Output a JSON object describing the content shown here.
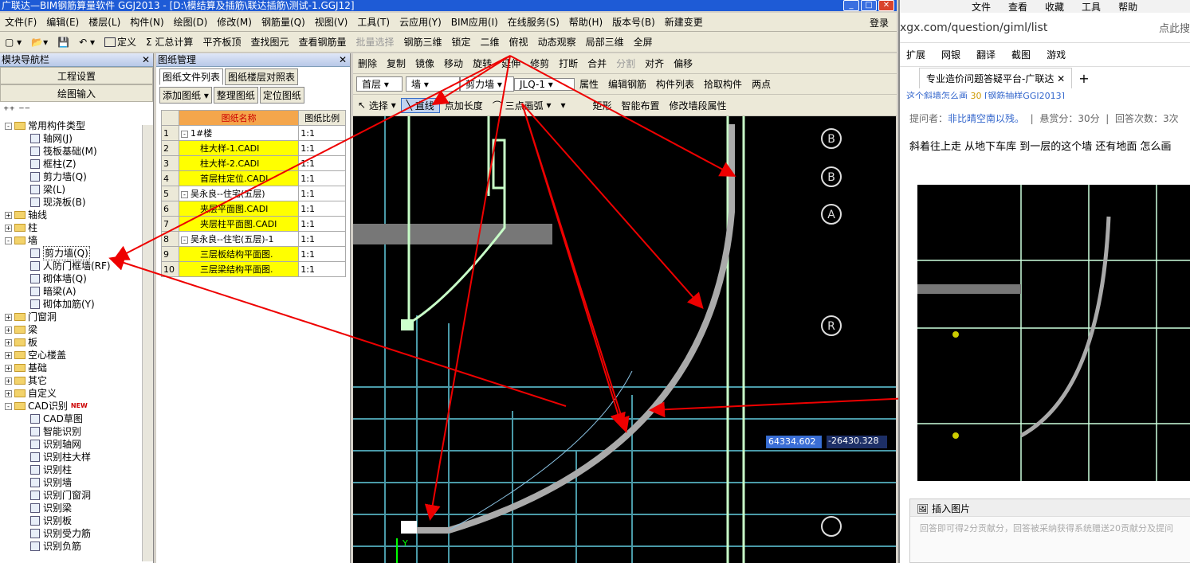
{
  "title": "广联达—BIM钢筋算量软件 GGJ2013 - [D:\\模结算及插筋\\联达插筋\\测试-1.GGJ12]",
  "menu": [
    "文件(F)",
    "编辑(E)",
    "楼层(L)",
    "构件(N)",
    "绘图(D)",
    "修改(M)",
    "钢筋量(Q)",
    "视图(V)",
    "工具(T)",
    "云应用(Y)",
    "BIM应用(I)",
    "在线服务(S)",
    "帮助(H)",
    "版本号(B)",
    "新建变更"
  ],
  "login": "登录",
  "toolbar1": [
    "定义",
    "Σ 汇总计算",
    "平齐板顶",
    "查找图元",
    "查看钢筋量",
    "批量选择",
    "钢筋三维",
    "锁定",
    "二维",
    "俯视",
    "动态观察",
    "局部三维",
    "全屏"
  ],
  "toolbar2": [
    "删除",
    "复制",
    "镜像",
    "移动",
    "旋转",
    "延伸",
    "修剪",
    "打断",
    "合并",
    "分割",
    "对齐",
    "偏移"
  ],
  "toolbar3": [
    "首层",
    "墙",
    "剪力墙",
    "JLQ-1",
    "属性",
    "编辑钢筋",
    "构件列表",
    "拾取构件",
    "两点"
  ],
  "toolbar4": [
    "选择",
    "直线",
    "点加长度",
    "三点画弧",
    "矩形",
    "智能布置",
    "修改墙段属性"
  ],
  "leftnav": {
    "header": "模块导航栏",
    "btn1": "工程设置",
    "btn2": "绘图输入",
    "tree": [
      {
        "lvl": 0,
        "pm": "-",
        "folder": true,
        "label": "常用构件类型"
      },
      {
        "lvl": 1,
        "label": "轴网(J)"
      },
      {
        "lvl": 1,
        "label": "筏板基础(M)"
      },
      {
        "lvl": 1,
        "label": "框柱(Z)"
      },
      {
        "lvl": 1,
        "label": "剪力墙(Q)"
      },
      {
        "lvl": 1,
        "label": "梁(L)"
      },
      {
        "lvl": 1,
        "label": "现浇板(B)"
      },
      {
        "lvl": 0,
        "pm": "+",
        "folder": true,
        "label": "轴线"
      },
      {
        "lvl": 0,
        "pm": "+",
        "folder": true,
        "label": "柱"
      },
      {
        "lvl": 0,
        "pm": "-",
        "folder": true,
        "label": "墙"
      },
      {
        "lvl": 1,
        "label": "剪力墙(Q)",
        "sel": true
      },
      {
        "lvl": 1,
        "label": "人防门框墙(RF)"
      },
      {
        "lvl": 1,
        "label": "砌体墙(Q)"
      },
      {
        "lvl": 1,
        "label": "暗梁(A)"
      },
      {
        "lvl": 1,
        "label": "砌体加筋(Y)"
      },
      {
        "lvl": 0,
        "pm": "+",
        "folder": true,
        "label": "门窗洞"
      },
      {
        "lvl": 0,
        "pm": "+",
        "folder": true,
        "label": "梁"
      },
      {
        "lvl": 0,
        "pm": "+",
        "folder": true,
        "label": "板"
      },
      {
        "lvl": 0,
        "pm": "+",
        "folder": true,
        "label": "空心楼盖"
      },
      {
        "lvl": 0,
        "pm": "+",
        "folder": true,
        "label": "基础"
      },
      {
        "lvl": 0,
        "pm": "+",
        "folder": true,
        "label": "其它"
      },
      {
        "lvl": 0,
        "pm": "+",
        "folder": true,
        "label": "自定义"
      },
      {
        "lvl": 0,
        "pm": "-",
        "folder": true,
        "label": "CAD识别",
        "new": "NEW"
      },
      {
        "lvl": 1,
        "label": "CAD草图"
      },
      {
        "lvl": 1,
        "label": "智能识别"
      },
      {
        "lvl": 1,
        "label": "识别轴网"
      },
      {
        "lvl": 1,
        "label": "识别柱大样"
      },
      {
        "lvl": 1,
        "label": "识别柱"
      },
      {
        "lvl": 1,
        "label": "识别墙"
      },
      {
        "lvl": 1,
        "label": "识别门窗洞"
      },
      {
        "lvl": 1,
        "label": "识别梁"
      },
      {
        "lvl": 1,
        "label": "识别板"
      },
      {
        "lvl": 1,
        "label": "识别受力筋"
      },
      {
        "lvl": 1,
        "label": "识别负筋"
      }
    ]
  },
  "drawing": {
    "header": "图纸管理",
    "tabs": [
      "图纸文件列表",
      "图纸楼层对照表"
    ],
    "buttons": [
      "添加图纸",
      "整理图纸",
      "定位图纸"
    ],
    "col1": "图纸名称",
    "col2": "图纸比例",
    "rows": [
      {
        "n": "1",
        "name": "1#楼",
        "scale": "1:1",
        "group": true
      },
      {
        "n": "2",
        "name": "柱大样-1.CADI",
        "scale": "1:1"
      },
      {
        "n": "3",
        "name": "柱大样-2.CADI",
        "scale": "1:1"
      },
      {
        "n": "4",
        "name": "首层柱定位.CADI",
        "scale": "1:1"
      },
      {
        "n": "5",
        "name": "吴永良--住宅(五层)",
        "scale": "1:1",
        "group": true
      },
      {
        "n": "6",
        "name": "夹层平面图.CADI",
        "scale": "1:1"
      },
      {
        "n": "7",
        "name": "夹层柱平面图.CADI",
        "scale": "1:1"
      },
      {
        "n": "8",
        "name": "吴永良--住宅(五层)-1",
        "scale": "1:1",
        "group": true
      },
      {
        "n": "9",
        "name": "三层板结构平面图.",
        "scale": "1:1"
      },
      {
        "n": "10",
        "name": "三层梁结构平面图.",
        "scale": "1:1"
      }
    ]
  },
  "cad": {
    "coord_x": "64334.602",
    "coord_y": "-26430.328",
    "axes": [
      "B",
      "B",
      "A",
      "R"
    ],
    "y_axis": "Y"
  },
  "browser": {
    "tabs_top": [
      "文件",
      "查看",
      "收藏",
      "工具",
      "帮助"
    ],
    "url": "xgx.com/question/giml/list",
    "search_hint": "点此搜",
    "fav": [
      "扩展",
      "网银",
      "翻译",
      "截图",
      "游戏"
    ],
    "tab_title": "专业造价问题答疑平台-广联达",
    "crumb": "这个斜墙怎么画",
    "reward": "30",
    "tag": "[钢筋抽样GGJ2013]",
    "asker_label": "提问者：",
    "asker": "非比晴空南以残。",
    "bounty": "悬赏分：30分",
    "answers": "回答次数：3次",
    "question": "斜着往上走 从地下车库 到一层的这个墙 还有地面 怎么画",
    "insert_image": "插入图片",
    "answer_hint": "回答即可得2分贡献分，回答被采纳获得系统赠送20贡献分及提问"
  }
}
